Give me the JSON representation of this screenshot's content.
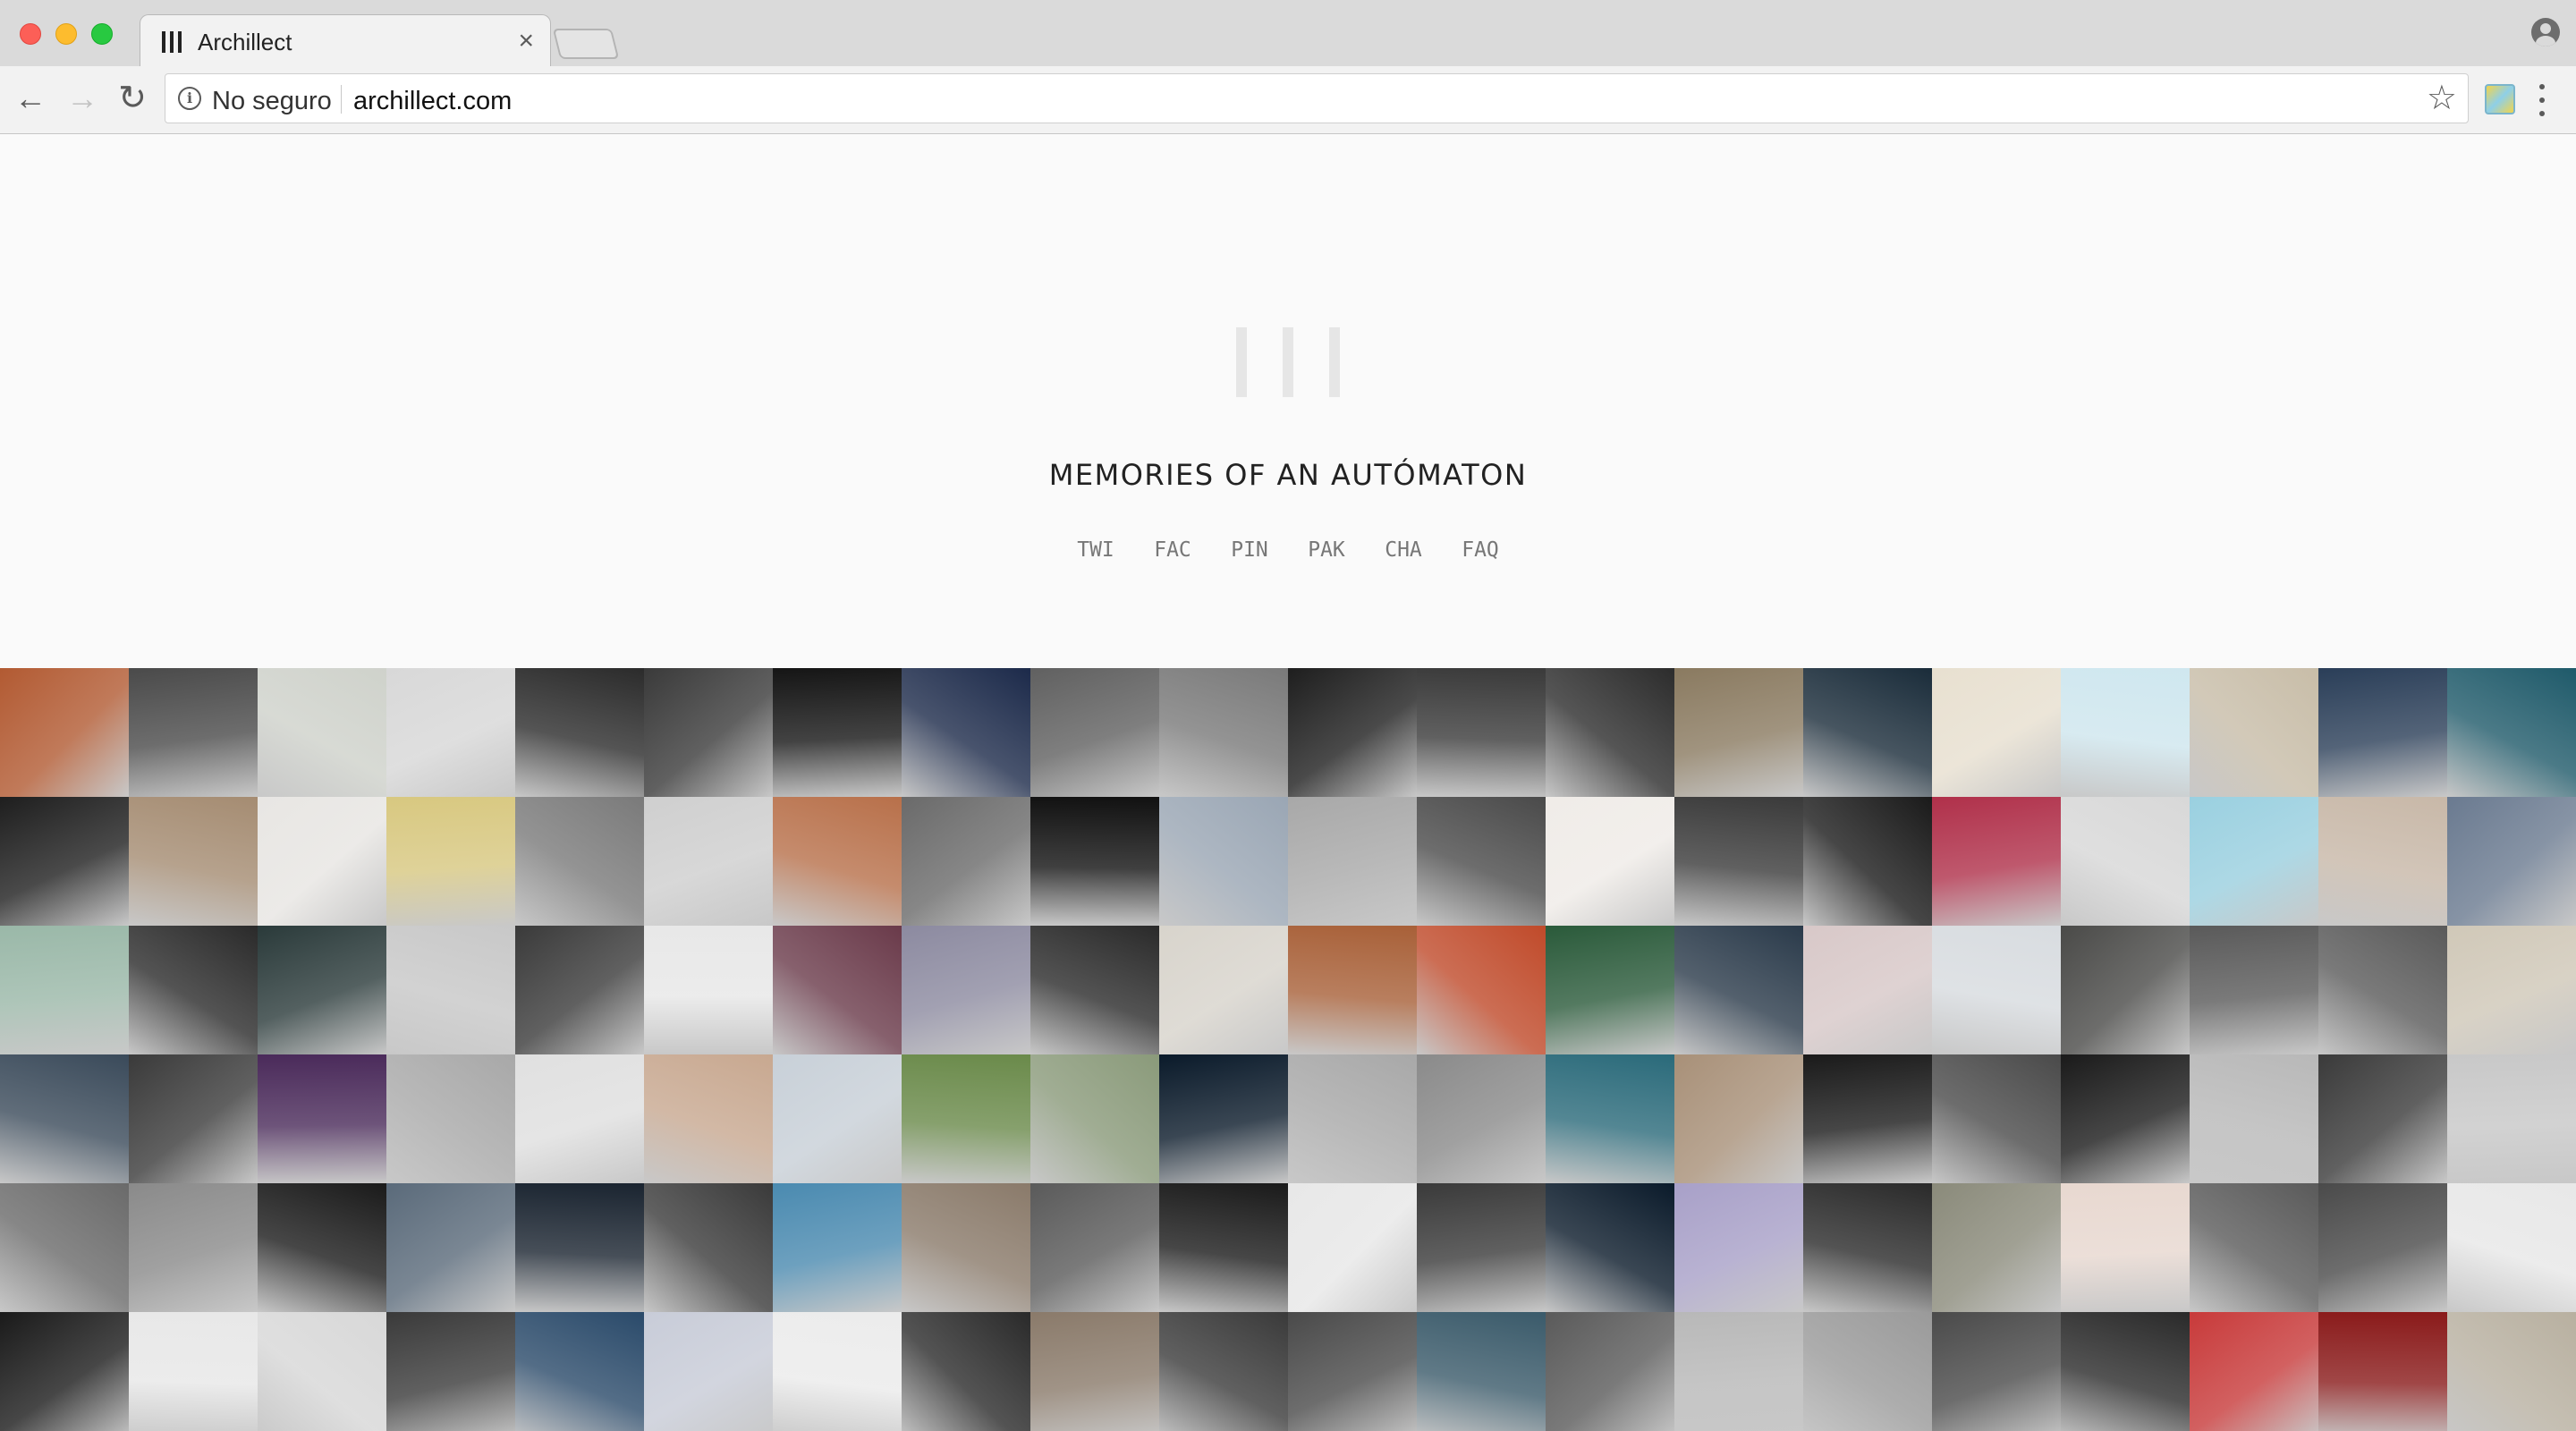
{
  "browser": {
    "tab_title": "Archillect",
    "tab_close": "×",
    "security_label": "No seguro",
    "url": "archillect.com",
    "icons": [
      "back-arrow-icon",
      "forward-arrow-icon",
      "reload-icon",
      "info-icon",
      "bookmark-star-icon",
      "extension-icon",
      "menu-icon",
      "profile-icon"
    ]
  },
  "page": {
    "tagline": "MEMORIES OF AN AUTÓMATON",
    "social_links": [
      "TWI",
      "FAC",
      "PIN",
      "PAK",
      "CHA",
      "FAQ"
    ]
  },
  "grid": {
    "columns": 20,
    "rows": 6,
    "tiles": [
      "#b25a32",
      "#4a4a4a",
      "#cfd2cb",
      "#d8d8d8",
      "#2b2b2b",
      "#3a3a3a",
      "#151515",
      "#1c2a4a",
      "#606060",
      "#7a7a7a",
      "#1e1e1e",
      "#3a3a3a",
      "#2c2c2c",
      "#8a7a60",
      "#1a2c3a",
      "#e8e0d0",
      "#cfe7ef",
      "#c8bda8",
      "#2a3e58",
      "#1f5a6a",
      "#1e1e1e",
      "#a58c72",
      "#e8e6e3",
      "#d8c880",
      "#7a7a7a",
      "#cfcfcf",
      "#b8704a",
      "#6a6a6a",
      "#111111",
      "#9aa6b4",
      "#a8a8a8",
      "#4a4a4a",
      "#f0ece8",
      "#3a3a3a",
      "#1a1a1a",
      "#b0304a",
      "#d8d8d8",
      "#9ad0e0",
      "#c8b8a8",
      "#6a7a90",
      "#9ab8a8",
      "#2a2a2a",
      "#2a3a3a",
      "#c8c8c8",
      "#3a3a3a",
      "#e8e8e8",
      "#6a3a4a",
      "#8c8aa0",
      "#2a2a2a",
      "#d8d4cc",
      "#a86038",
      "#c04a2a",
      "#2a5a3a",
      "#2a3a4a",
      "#d8c8c8",
      "#d8dce0",
      "#4a4a48",
      "#5a5a5a",
      "#5a5a5a",
      "#d0c8b8",
      "#3a4a5a",
      "#3a3a3a",
      "#4a2a5a",
      "#a8a8a8",
      "#e0e0e0",
      "#c8a890",
      "#c8d0d8",
      "#6a8a4a",
      "#8a9a7a",
      "#0a1a2a",
      "#a8a8a8",
      "#8a8a8a",
      "#2a6a7a",
      "#a89078",
      "#1a1a1a",
      "#4a4a4a",
      "#1a1a1a",
      "#b8b8b8",
      "#3a3a3a",
      "#c8c8c8",
      "#6a6a6a",
      "#8a8a8a",
      "#1a1a1a",
      "#5a6a7a",
      "#1a2430",
      "#3a3a3a",
      "#4a8ab0",
      "#8a7a6a",
      "#5a5a5a",
      "#1a1a1a",
      "#e8e8e8",
      "#3a3a3a",
      "#0a1a2a",
      "#a8a0c8",
      "#2a2a2a",
      "#8a8a7a",
      "#e8d8d0",
      "#5a5a5a",
      "#4a4a4a",
      "#e8e8e8",
      "#1a1a1a",
      "#e8e8e8",
      "#d8d8d8",
      "#3a3a3a",
      "#2a4a6a",
      "#c8ccd8",
      "#ececec",
      "#2a2a2a",
      "#8a7a6a",
      "#3a3a3a",
      "#4a4a4a",
      "#3a5a6a",
      "#5a5a5a",
      "#b8b8b8",
      "#9a9a9a",
      "#4a4a4a",
      "#2a2a2a",
      "#c83a3a",
      "#8a1a1a",
      "#b8b0a0"
    ]
  }
}
